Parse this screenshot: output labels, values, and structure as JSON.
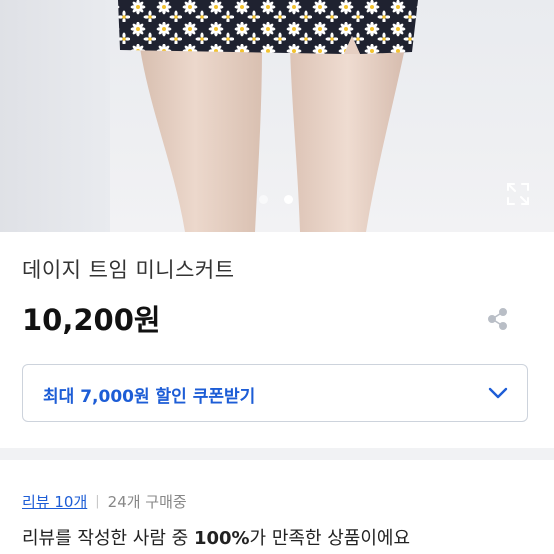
{
  "product": {
    "title": "데이지 트임 미니스커트",
    "price": "10,200원"
  },
  "gallery": {
    "slide_count": 2,
    "active_slide": 2,
    "expand_icon": "expand-icon"
  },
  "share_icon": "share-icon",
  "coupon": {
    "label": "최대 7,000원 할인 쿠폰받기",
    "icon": "chevron-down-icon"
  },
  "reviews": {
    "link_label": "리뷰 10개",
    "separator": "|",
    "purchase_count": "24개 구매중",
    "summary_prefix": "리뷰를 작성한 사람 중 ",
    "summary_highlight": "100%",
    "summary_suffix": "가 만족한 상품이에요"
  },
  "colors": {
    "accent": "#1d5dd6",
    "skirt": "#1f2230",
    "daisy_petal": "#ffffff",
    "daisy_center": "#f2c230"
  }
}
